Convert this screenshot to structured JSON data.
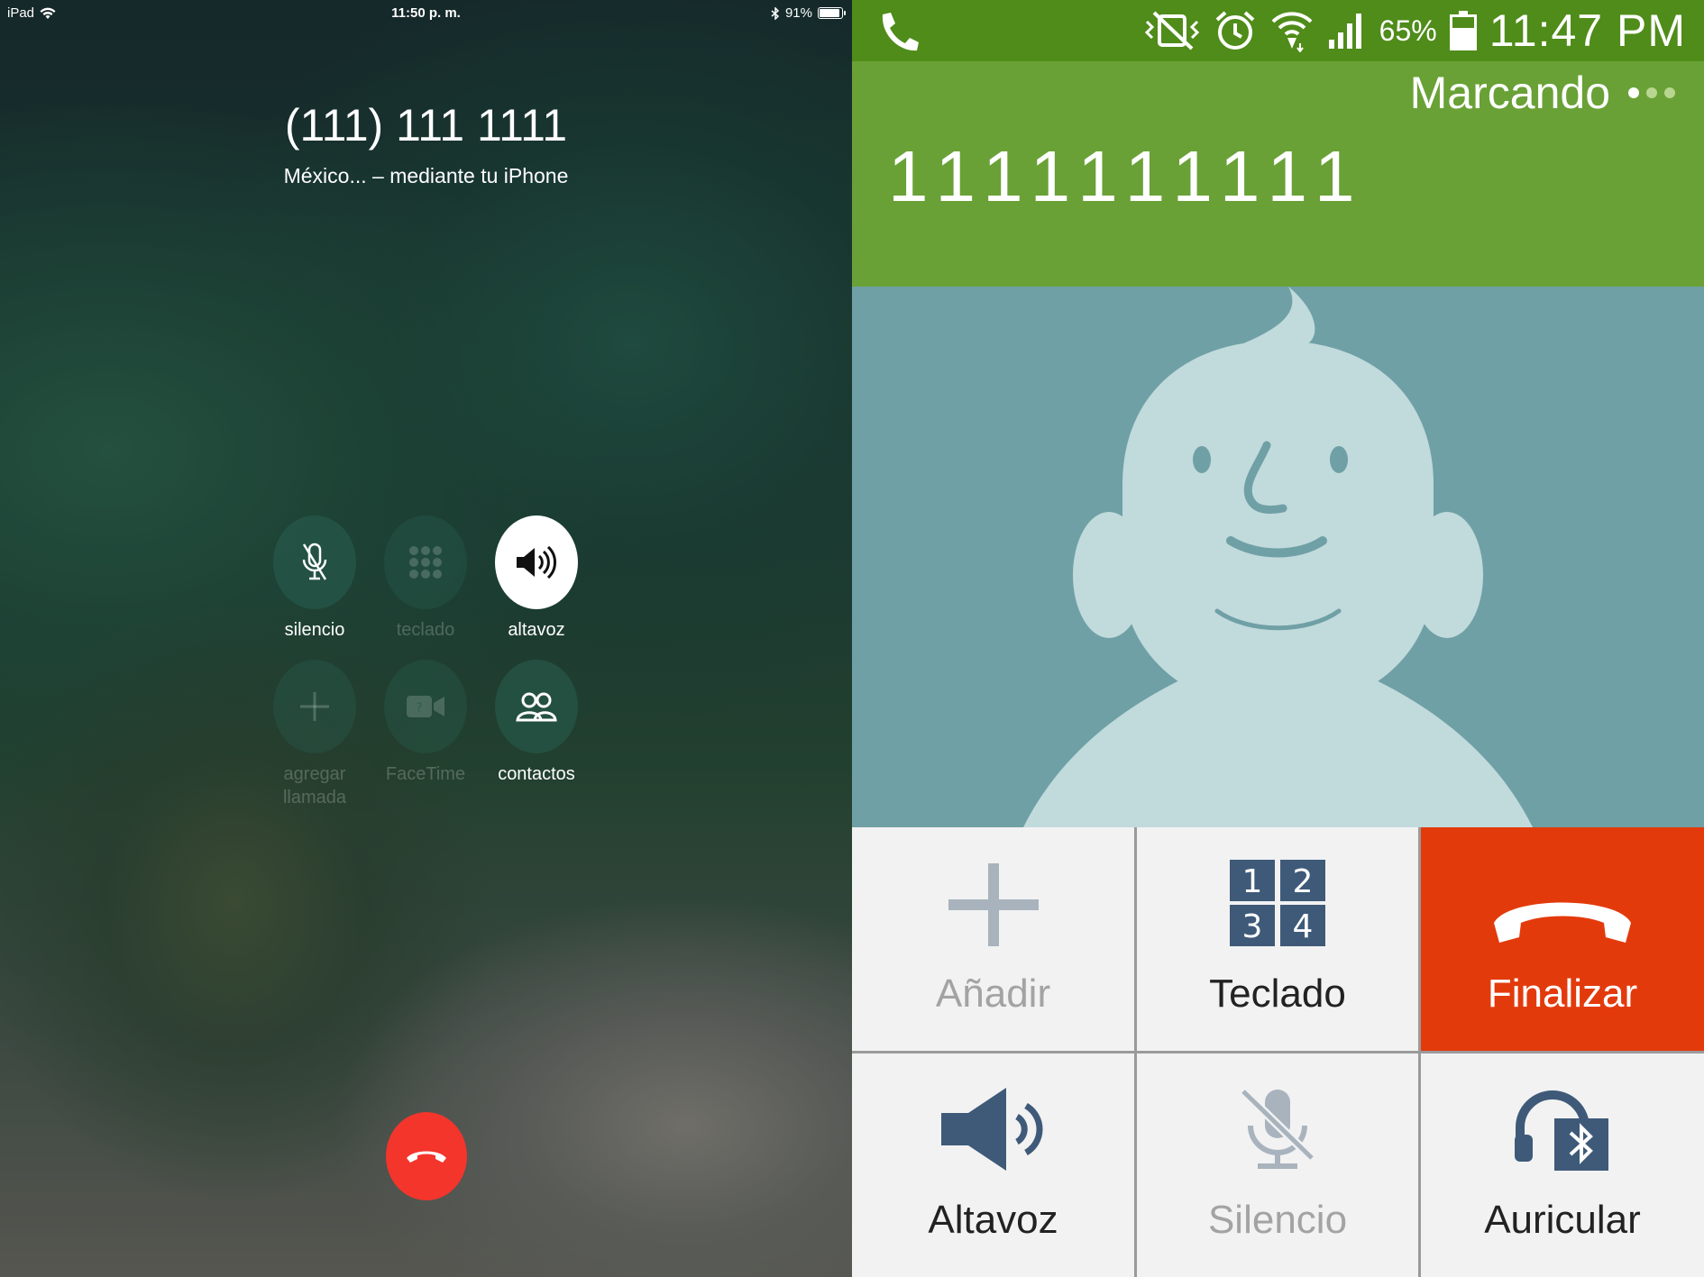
{
  "ipad": {
    "status": {
      "device": "iPad",
      "time": "11:50 p. m.",
      "battery": "91%",
      "battery_level": 0.91
    },
    "call": {
      "number": "(111) 111 1111",
      "subtitle": "México... – mediante tu iPhone"
    },
    "controls": [
      {
        "label": "silencio",
        "icon": "mic-muted-icon",
        "state": "enabled"
      },
      {
        "label": "teclado",
        "icon": "keypad-icon",
        "state": "disabled"
      },
      {
        "label": "altavoz",
        "icon": "speaker-icon",
        "state": "active"
      },
      {
        "label": "agregar llamada",
        "icon": "add-icon",
        "state": "disabled"
      },
      {
        "label": "FaceTime",
        "icon": "facetime-icon",
        "state": "disabled"
      },
      {
        "label": "contactos",
        "icon": "contacts-icon",
        "state": "enabled"
      }
    ],
    "end_call_color": "#f3352c"
  },
  "android": {
    "status": {
      "battery": "65%",
      "battery_level": 0.65,
      "time": "11:47 PM",
      "bar_color": "#4f8c19"
    },
    "header": {
      "state": "Marcando",
      "number": "1111111111",
      "color": "#69a136"
    },
    "avatar_bg": "#6fa0a5",
    "buttons": [
      {
        "label": "Añadir",
        "icon": "add-icon",
        "state": "disabled"
      },
      {
        "label": "Teclado",
        "icon": "keypad-icon",
        "keys": [
          "1",
          "2",
          "3",
          "4"
        ],
        "state": "enabled"
      },
      {
        "label": "Finalizar",
        "icon": "end-call-icon",
        "state": "danger",
        "color": "#e33a0c"
      },
      {
        "label": "Altavoz",
        "icon": "speaker-icon",
        "state": "enabled"
      },
      {
        "label": "Silencio",
        "icon": "mic-muted-icon",
        "state": "disabled"
      },
      {
        "label": "Auricular",
        "icon": "bluetooth-headset-icon",
        "state": "enabled"
      }
    ]
  }
}
